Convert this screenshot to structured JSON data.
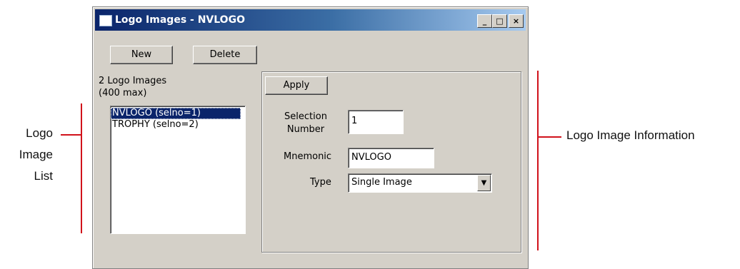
{
  "annotations": {
    "left_label_lines": [
      "Logo",
      "Image",
      "List"
    ],
    "right_label": "Logo Image Information"
  },
  "window": {
    "title": "Logo Images - NVLOGO",
    "controls": {
      "minimize": "_",
      "maximize": "□",
      "close": "×"
    }
  },
  "toolbar": {
    "new_label": "New",
    "delete_label": "Delete"
  },
  "list_panel": {
    "count_line1": "2 Logo Images",
    "count_line2": "(400 max)",
    "items": [
      {
        "label": "NVLOGO (selno=1)",
        "selected": true
      },
      {
        "label": "TROPHY (selno=2)",
        "selected": false
      }
    ]
  },
  "info_panel": {
    "apply_label": "Apply",
    "selection_number_label_line1": "Selection",
    "selection_number_label_line2": "Number",
    "selection_number_value": "1",
    "mnemonic_label": "Mnemonic",
    "mnemonic_value": "NVLOGO",
    "type_label": "Type",
    "type_value": "Single Image"
  },
  "colors": {
    "annotation_line": "#d1121b",
    "window_face": "#d4d0c8",
    "titlebar_start": "#0a246a",
    "selection": "#0a246a"
  }
}
